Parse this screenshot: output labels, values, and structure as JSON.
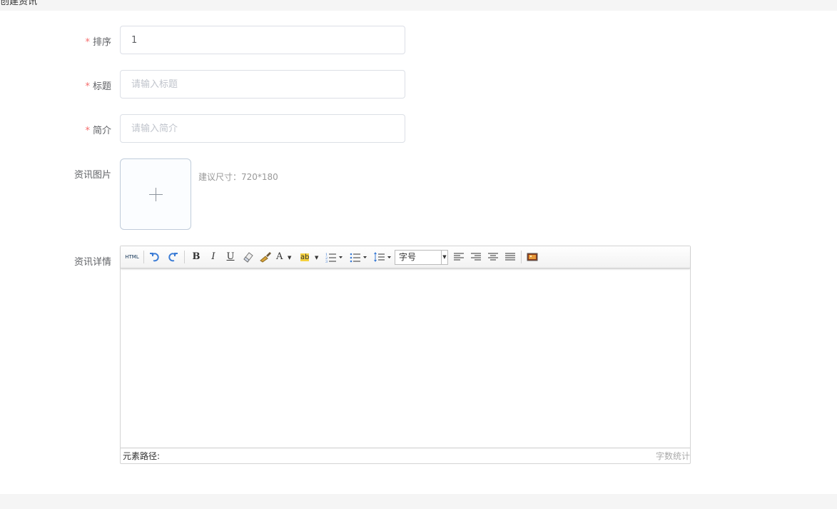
{
  "page": {
    "title": "创建资讯"
  },
  "form": {
    "sort": {
      "label": "排序",
      "required_mark": "*",
      "value": "1"
    },
    "title": {
      "label": "标题",
      "required_mark": "*",
      "placeholder": "请输入标题"
    },
    "intro": {
      "label": "简介",
      "required_mark": "*",
      "placeholder": "请输入简介"
    },
    "image": {
      "label": "资讯图片",
      "hint": "建议尺寸：720*180"
    },
    "detail": {
      "label": "资讯详情"
    }
  },
  "editor": {
    "toolbar": {
      "html": "HTML",
      "bold": "B",
      "italic": "I",
      "underline": "U",
      "font_color": "A",
      "highlight": "ab",
      "font_size": "字号"
    },
    "status": {
      "path": "元素路径:",
      "word_count": "字数统计"
    }
  }
}
